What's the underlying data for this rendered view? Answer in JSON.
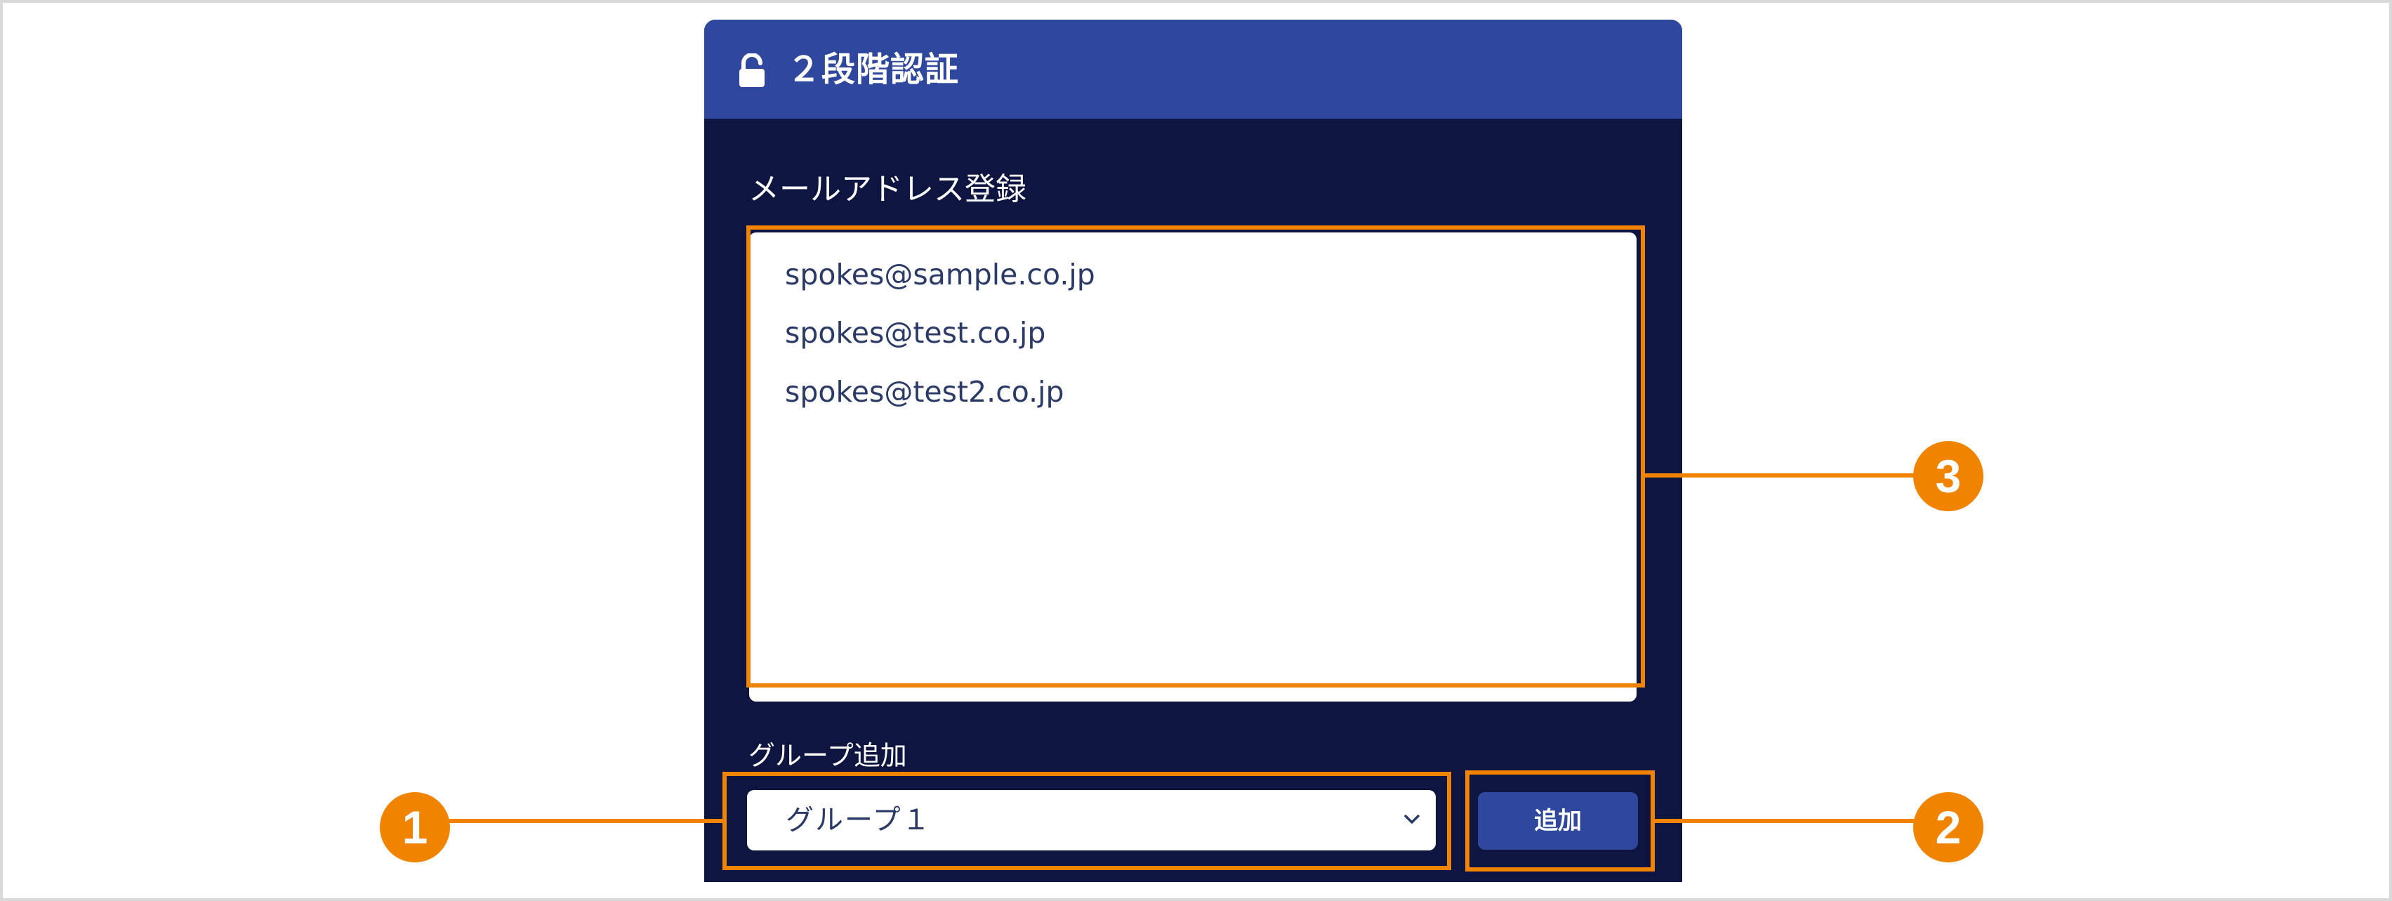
{
  "header": {
    "title": "２段階認証",
    "lock_icon": "lock-open-icon"
  },
  "email_section": {
    "label": "メールアドレス登録",
    "emails": [
      "spokes@sample.co.jp",
      "spokes@test.co.jp",
      "spokes@test2.co.jp"
    ]
  },
  "group_section": {
    "label": "グループ追加",
    "selected_group": "グループ１",
    "add_button_label": "追加"
  },
  "callouts": {
    "one": "1",
    "two": "2",
    "three": "3"
  },
  "colors": {
    "panel": "#0e1540",
    "header": "#2f479c",
    "accent": "#f08300"
  }
}
